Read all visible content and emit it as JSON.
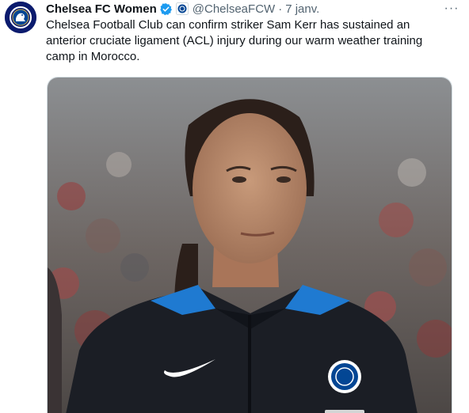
{
  "tweet": {
    "author_name": "Chelsea FC Women",
    "handle": "@ChelseaFCW",
    "separator": "·",
    "timestamp": "7 janv.",
    "text": "Chelsea Football Club can confirm striker Sam Kerr has sustained an anterior cruciate ligament (ACL) injury during our warm weather training camp in Morocco.",
    "more_glyph": "···"
  },
  "icons": {
    "avatar": "chelsea-crest-icon",
    "verified": "verified-badge-icon",
    "affiliate": "chelsea-affiliate-badge-icon",
    "more": "more-options-icon"
  },
  "colors": {
    "verified_blue": "#1d9bf0",
    "chelsea_blue": "#034694",
    "text_secondary": "#536471"
  }
}
